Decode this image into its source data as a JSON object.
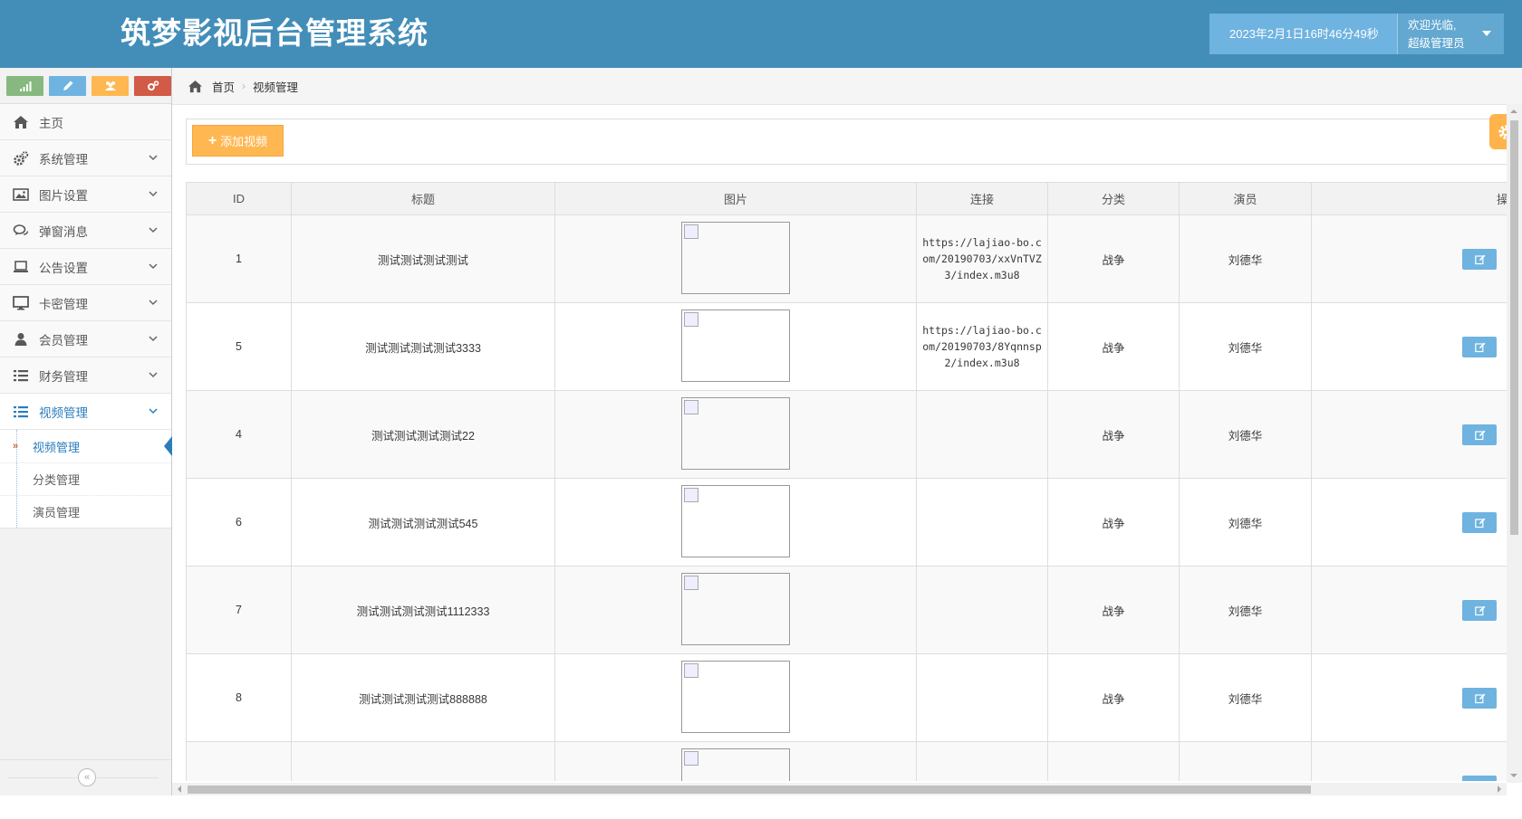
{
  "app": {
    "title": "筑梦影视后台管理系统"
  },
  "header": {
    "datetime": "2023年2月1日16时46分49秒",
    "welcome": "欢迎光临,",
    "role": "超级管理员"
  },
  "sidebar": {
    "items": [
      {
        "label": "主页",
        "icon": "home-icon"
      },
      {
        "label": "系统管理",
        "icon": "cogs-icon"
      },
      {
        "label": "图片设置",
        "icon": "picture-icon"
      },
      {
        "label": "弹窗消息",
        "icon": "comments-icon"
      },
      {
        "label": "公告设置",
        "icon": "laptop-icon"
      },
      {
        "label": "卡密管理",
        "icon": "desktop-icon"
      },
      {
        "label": "会员管理",
        "icon": "user-icon"
      },
      {
        "label": "财务管理",
        "icon": "list-icon"
      },
      {
        "label": "视频管理",
        "icon": "list-icon"
      }
    ],
    "submenu": [
      {
        "label": "视频管理"
      },
      {
        "label": "分类管理"
      },
      {
        "label": "演员管理"
      }
    ]
  },
  "breadcrumb": {
    "home": "首页",
    "current": "视频管理"
  },
  "toolbar": {
    "add_label": "添加视频"
  },
  "table": {
    "headers": [
      "ID",
      "标题",
      "图片",
      "连接",
      "分类",
      "演员",
      "操"
    ],
    "rows": [
      {
        "id": "1",
        "title": "测试测试测试测试",
        "link": "https://lajiao-bo.com/20190703/xxVnTVZ3/index.m3u8",
        "category": "战争",
        "actor": "刘德华"
      },
      {
        "id": "5",
        "title": "测试测试测试测试3333",
        "link": "https://lajiao-bo.com/20190703/8Yqnnsp2/index.m3u8",
        "category": "战争",
        "actor": "刘德华"
      },
      {
        "id": "4",
        "title": "测试测试测试测试22",
        "link": "",
        "category": "战争",
        "actor": "刘德华"
      },
      {
        "id": "6",
        "title": "测试测试测试测试545",
        "link": "",
        "category": "战争",
        "actor": "刘德华"
      },
      {
        "id": "7",
        "title": "测试测试测试测试1112333",
        "link": "",
        "category": "战争",
        "actor": "刘德华"
      },
      {
        "id": "8",
        "title": "测试测试测试测试888888",
        "link": "",
        "category": "战争",
        "actor": "刘德华"
      },
      {
        "id": "",
        "title": "",
        "link": "",
        "category": "",
        "actor": ""
      }
    ]
  },
  "colors": {
    "header_bg": "#438eb9",
    "accent": "#2b7dbc",
    "add_button": "#ffb752",
    "edit_button": "#6fb3e0"
  }
}
